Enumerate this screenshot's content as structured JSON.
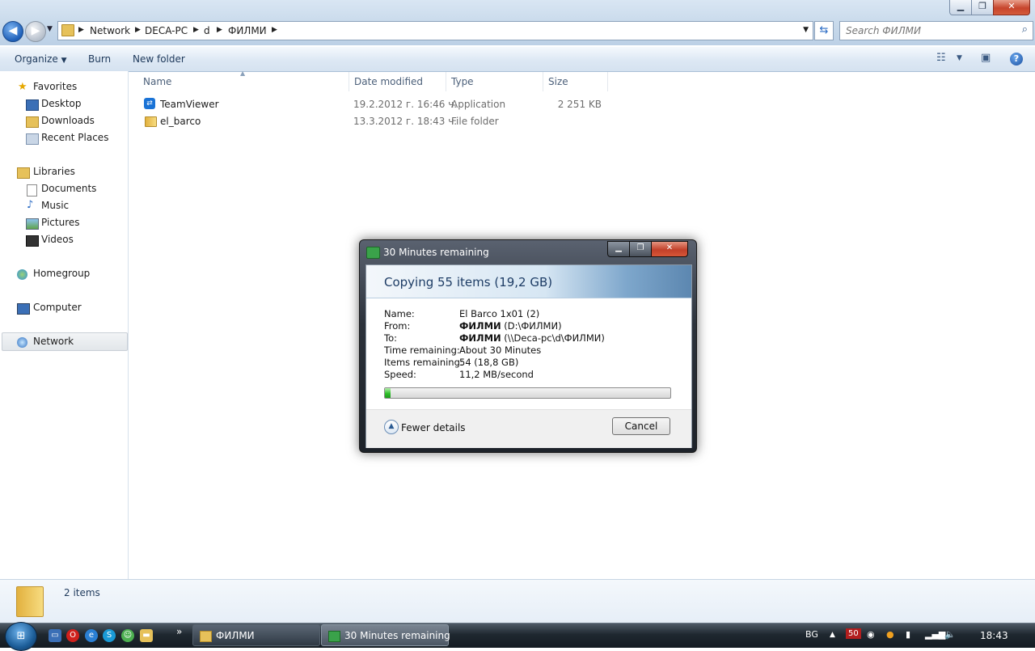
{
  "window": {
    "breadcrumbs": [
      "Network",
      "DECA-PC",
      "d",
      "ФИЛМИ"
    ],
    "search_placeholder": "Search ФИЛМИ"
  },
  "toolbar": {
    "organize": "Organize",
    "burn": "Burn",
    "new_folder": "New folder"
  },
  "nav": {
    "favorites": "Favorites",
    "desktop": "Desktop",
    "downloads": "Downloads",
    "recent": "Recent Places",
    "libraries": "Libraries",
    "documents": "Documents",
    "music": "Music",
    "pictures": "Pictures",
    "videos": "Videos",
    "homegroup": "Homegroup",
    "computer": "Computer",
    "network": "Network"
  },
  "columns": {
    "name": "Name",
    "date": "Date modified",
    "type": "Type",
    "size": "Size"
  },
  "files": [
    {
      "name": "TeamViewer",
      "date": "19.2.2012 г. 16:46 ч.",
      "type": "Application",
      "size": "2 251 KB"
    },
    {
      "name": "el_barco",
      "date": "13.3.2012 г. 18:43 ч.",
      "type": "File folder",
      "size": ""
    }
  ],
  "status": {
    "count": "2 items"
  },
  "dialog": {
    "title": "30 Minutes remaining",
    "heading": "Copying 55 items (19,2 GB)",
    "labels": {
      "name": "Name:",
      "from": "From:",
      "to": "To:",
      "time": "Time remaining:",
      "items": "Items remaining:",
      "speed": "Speed:"
    },
    "name_value": "El Barco 1x01 (2)",
    "from_bold": "ФИЛМИ",
    "from_rest": " (D:\\ФИЛМИ)",
    "to_bold": "ФИЛМИ",
    "to_rest": " (\\\\Deca-pc\\d\\ФИЛМИ)",
    "time_value": "About 30 Minutes",
    "items_value": "54 (18,8 GB)",
    "speed_value": "11,2 MB/second",
    "progress_fraction": 0.02,
    "fewer_details": "Fewer details",
    "cancel": "Cancel"
  },
  "taskbar": {
    "task1": "ФИЛМИ",
    "task2": "30 Minutes remaining",
    "lang": "BG",
    "badge": "50",
    "clock": "18:43",
    "more": "»"
  },
  "colors": {
    "accent": "#1d3c65",
    "progress": "#2fbf2a",
    "close": "#c7452c"
  }
}
